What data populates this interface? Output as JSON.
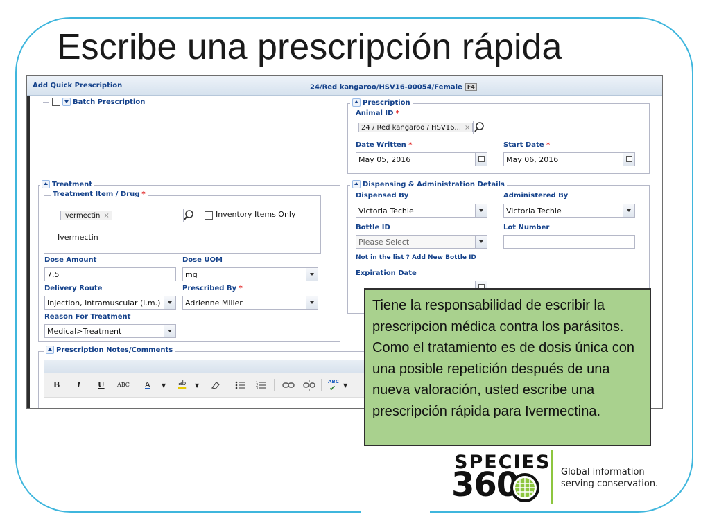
{
  "slide": {
    "title": "Escribe una prescripción rápida"
  },
  "window": {
    "title": "Add Quick Prescription",
    "animal_header": "24/Red kangaroo/HSV16-00054/Female",
    "animal_header_badge": "F4"
  },
  "batch": {
    "legend": "Batch Prescription"
  },
  "prescription": {
    "legend": "Prescription",
    "animal_id_label": "Animal ID",
    "animal_id_value": "24 / Red kangaroo / HSV16...",
    "date_written_label": "Date Written",
    "date_written_value": "May 05, 2016",
    "start_date_label": "Start Date",
    "start_date_value": "May 06, 2016"
  },
  "treatment": {
    "legend": "Treatment",
    "drug_legend": "Treatment Item / Drug",
    "drug_tag": "Ivermectin",
    "inventory_only_label": "Inventory Items Only",
    "drug_selected_text": "Ivermectin",
    "dose_amount_label": "Dose Amount",
    "dose_amount_value": "7.5",
    "dose_uom_label": "Dose UOM",
    "dose_uom_value": "mg",
    "delivery_route_label": "Delivery Route",
    "delivery_route_value": "Injection, intramuscular (i.m.)",
    "prescribed_by_label": "Prescribed By",
    "prescribed_by_value": "Adrienne Miller",
    "reason_label": "Reason For Treatment",
    "reason_value": "Medical>Treatment"
  },
  "dispensing": {
    "legend": "Dispensing & Administration Details",
    "dispensed_by_label": "Dispensed By",
    "dispensed_by_value": "Victoria Techie",
    "administered_by_label": "Administered By",
    "administered_by_value": "Victoria Techie",
    "bottle_id_label": "Bottle ID",
    "bottle_id_placeholder": "Please Select",
    "lot_number_label": "Lot Number",
    "add_bottle_link": "Not in the list ? Add New Bottle ID",
    "expiration_label": "Expiration Date"
  },
  "notes": {
    "legend": "Prescription Notes/Comments",
    "toolbar": {
      "bold": "B",
      "italic": "I",
      "underline": "U",
      "strike": "ABC",
      "font_color": "A",
      "highlight": "ab",
      "spell": "ABC"
    }
  },
  "callout": {
    "text": "Tiene la responsabilidad de escribir la prescripcion médica contra los parásitos.  Como el tratamiento es de dosis única con una posible repetición después de una nueva valoración, usted escribe una prescripción rápida para Ivermectina."
  },
  "logo": {
    "line1": "SPECIES",
    "line2": "360",
    "tagline_1": "Global information",
    "tagline_2": "serving conservation."
  },
  "colors": {
    "frame": "#3fb6dd",
    "panel_text": "#15428b",
    "callout_bg": "#a9d18e",
    "logo_accent": "#8dc63f"
  }
}
